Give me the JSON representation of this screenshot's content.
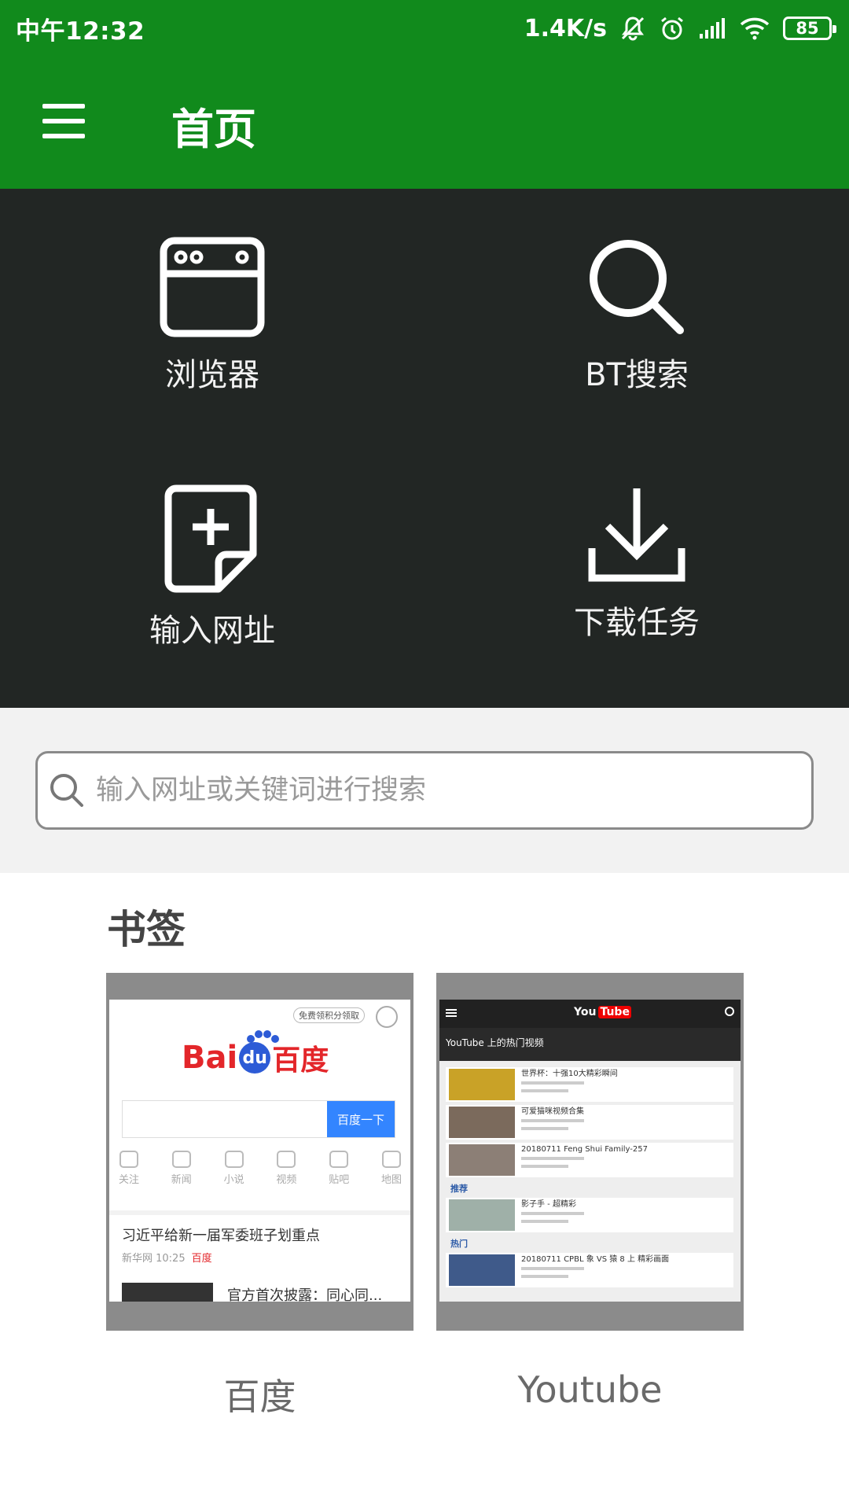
{
  "status_bar": {
    "time": "中午12:32",
    "net_speed": "1.4K/s",
    "battery": "85",
    "icons": [
      "mute-icon",
      "alarm-icon",
      "signal-icon",
      "wifi-icon",
      "battery-icon"
    ]
  },
  "toolbar": {
    "title": "首页",
    "menu_icon": "hamburger-menu-icon"
  },
  "quick_actions": [
    {
      "label": "浏览器",
      "icon": "browser-window-icon"
    },
    {
      "label": "BT搜索",
      "icon": "search-icon"
    },
    {
      "label": "输入网址",
      "icon": "add-document-icon"
    },
    {
      "label": "下载任务",
      "icon": "download-icon"
    }
  ],
  "search": {
    "placeholder": "输入网址或关键词进行搜索"
  },
  "bookmarks": {
    "title": "书签",
    "items": [
      {
        "label": "百度",
        "preview": {
          "top_button": "免费领积分领取",
          "logo_left": "Bai",
          "logo_mid": "du",
          "logo_right": "百度",
          "search_button": "百度一下",
          "icons": [
            "关注",
            "新闻",
            "小说",
            "视频",
            "贴吧",
            "地图"
          ],
          "headline": "习近平给新一届军委班子划重点",
          "meta": "新华网 10:25",
          "meta_tag": "百度",
          "headline2": "官方首次披露：同心同..."
        }
      },
      {
        "label": "Youtube",
        "preview": {
          "logo_you": "You",
          "logo_tube": "Tube",
          "header": "YouTube 上的热门视频",
          "items": [
            "世界杯：十强10大精彩瞬间",
            "可爱猫咪视频合集",
            "20180711 Feng Shui Family-257",
            "影子手 - 超精彩",
            "20180711 CPBL 象 VS 猿 8 上 精彩画面"
          ],
          "sections": [
            "推荐",
            "热门"
          ]
        }
      }
    ]
  },
  "colors": {
    "toolbar": "#118a1c",
    "grid_bg": "#222624",
    "search_bg": "#f2f2f2"
  }
}
